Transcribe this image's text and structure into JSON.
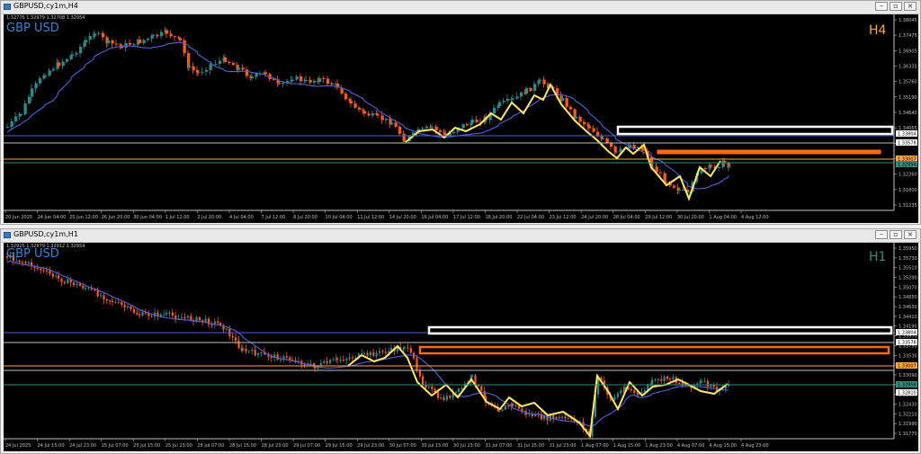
{
  "colors": {
    "bull": "#2e8b8b",
    "bear": "#ff5a1a",
    "ma": "#4f62d6",
    "zigzag": "#ffe866",
    "symbol": "#2f86d6",
    "timeframe": "#ffa640",
    "timeframe_h1": "#2f8f7a",
    "grid": "#bfbfbf"
  },
  "icons": {
    "window": "chart-window-icon",
    "minimize": "minimize-icon",
    "restore": "restore-icon",
    "close": "close-icon"
  },
  "h4": {
    "window_title": "GBPUSD,cy1m,H4",
    "ohlc_text": "1.32776 1.32979 1.32708 1.32954",
    "symbol": "GBP USD",
    "timeframe": "H4",
    "price_labels": [
      "1.38045",
      "1.37475",
      "1.36905",
      "1.36335",
      "1.35760",
      "1.35190",
      "1.34640",
      "1.34065",
      "1.33500",
      "1.32930",
      "1.32360",
      "1.31800",
      "1.31235"
    ],
    "tag_labels": [
      {
        "text": "1.33804",
        "color": "#ffffff"
      },
      {
        "text": "1.33578",
        "color": "#ffffff"
      },
      {
        "text": "1.33007",
        "color": "#ffa640"
      },
      {
        "text": "1.32954",
        "color": "#2f8f7a"
      }
    ],
    "time_labels": [
      "20 Jun 2025",
      "24 Jun 04:00",
      "25 Jun 12:00",
      "26 Jun 20:00",
      "30 Jun 04:00",
      "1 Jul 12:00",
      "2 Jul 20:00",
      "4 Jul 04:00",
      "7 Jul 12:00",
      "8 Jul 20:00",
      "10 Jul 04:00",
      "11 Jul 12:00",
      "14 Jul 20:00",
      "16 Jul 04:00",
      "17 Jul 12:00",
      "18 Jul 20:00",
      "22 Jul 04:00",
      "23 Jul 12:00",
      "24 Jul 20:00",
      "28 Jul 04:00",
      "29 Jul 12:00",
      "30 Jul 20:00",
      "1 Aug 04:00",
      "4 Aug 12:00"
    ]
  },
  "h1": {
    "window_title": "GBPUSD,cy1m,H1",
    "ohlc_text": "1.32925 1.32979 1.32912 1.32954",
    "symbol": "GBP USD",
    "timeframe": "H1",
    "price_labels": [
      "1.35950",
      "1.35730",
      "1.35510",
      "1.35290",
      "1.35070",
      "1.34850",
      "1.34630",
      "1.34410",
      "1.34190",
      "1.33970",
      "1.33750",
      "1.33530",
      "1.33310",
      "1.33090",
      "1.32870",
      "1.32650",
      "1.32430",
      "1.32210",
      "1.31990",
      "1.31770"
    ],
    "tag_labels": [
      {
        "text": "1.33804",
        "color": "#ffffff"
      },
      {
        "text": "1.33578",
        "color": "#ffffff"
      },
      {
        "text": "1.33007",
        "color": "#ffa640"
      },
      {
        "text": "1.32954",
        "color": "#2f8f7a"
      },
      {
        "text": "1.32810",
        "color": "#ffffff"
      }
    ],
    "time_labels": [
      "24 Jul 2025",
      "24 Jul 15:00",
      "24 Jul 23:00",
      "25 Jul 07:00",
      "25 Jul 15:00",
      "25 Jul 23:00",
      "28 Jul 07:00",
      "28 Jul 15:00",
      "28 Jul 23:00",
      "29 Jul 07:00",
      "29 Jul 15:00",
      "29 Jul 23:00",
      "30 Jul 07:00",
      "30 Jul 15:00",
      "30 Jul 23:00",
      "31 Jul 07:00",
      "31 Jul 15:00",
      "31 Jul 23:00",
      "1 Aug 07:00",
      "1 Aug 15:00",
      "1 Aug 23:00",
      "4 Aug 07:00",
      "4 Aug 15:00",
      "4 Aug 23:00"
    ]
  }
}
